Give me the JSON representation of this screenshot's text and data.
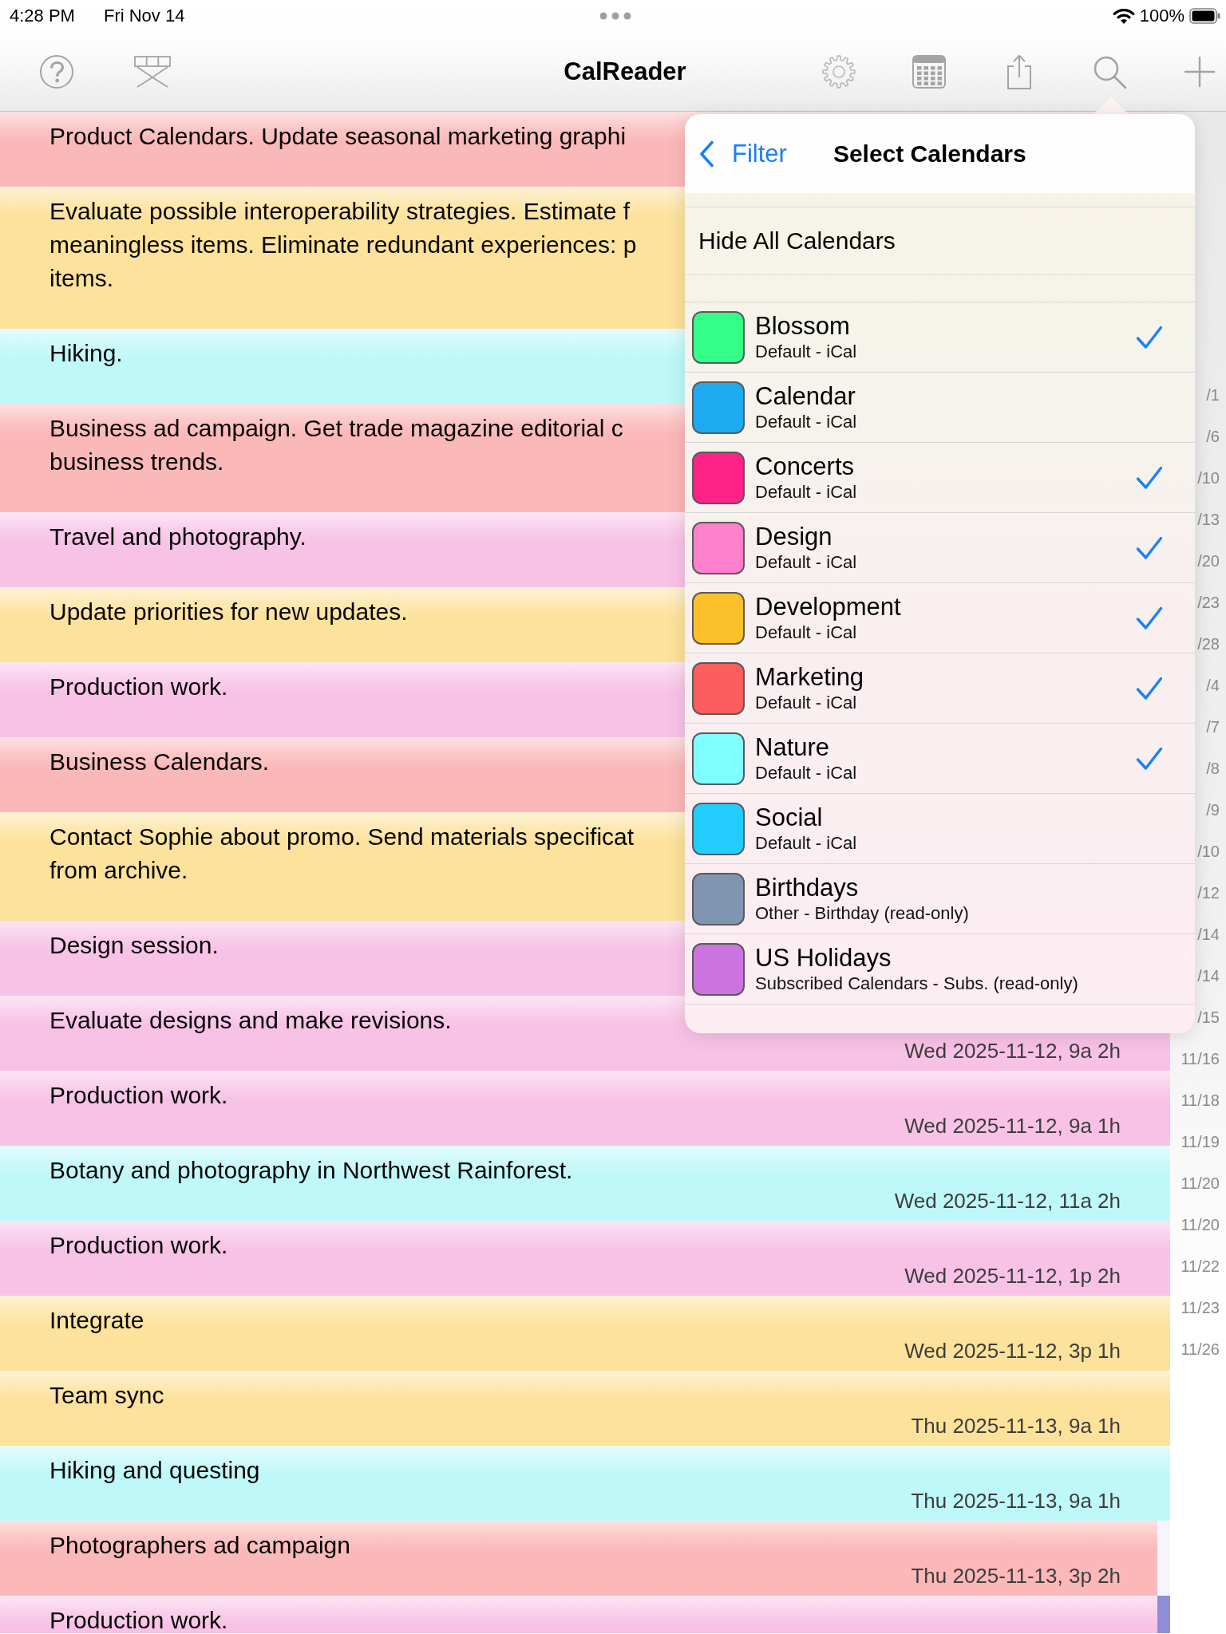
{
  "status_bar": {
    "time": "4:28 PM",
    "date": "Fri Nov 14",
    "battery": "100%"
  },
  "toolbar": {
    "title": "CalReader"
  },
  "events": [
    {
      "lines": [
        "Product Calendars. Update seasonal marketing graphi"
      ],
      "color": "#fbb8b8"
    },
    {
      "lines": [
        "Evaluate possible interoperability strategies. Estimate f",
        "meaningless items. Eliminate redundant experiences: p",
        "items."
      ],
      "color": "#fde29c"
    },
    {
      "lines": [
        "Hiking."
      ],
      "color": "#bff8f8"
    },
    {
      "lines": [
        "Business ad campaign. Get trade magazine editorial c",
        "business trends."
      ],
      "color": "#fbb8b8"
    },
    {
      "lines": [
        "Travel and photography."
      ],
      "color": "#f8c2e6"
    },
    {
      "lines": [
        "Update priorities for new updates."
      ],
      "color": "#fde29c"
    },
    {
      "lines": [
        "Production work."
      ],
      "color": "#f8c2e6"
    },
    {
      "lines": [
        "Business Calendars."
      ],
      "color": "#fbb8b8"
    },
    {
      "lines": [
        "Contact Sophie about promo. Send materials specificat",
        "from archive."
      ],
      "color": "#fde29c"
    },
    {
      "lines": [
        "Design session."
      ],
      "color": "#f8c2e6"
    },
    {
      "lines": [
        "Evaluate designs and make revisions."
      ],
      "date": "Wed 2025-11-12, 9a 2h",
      "color": "#f8c2e6"
    },
    {
      "lines": [
        "Production work."
      ],
      "date": "Wed 2025-11-12, 9a 1h",
      "color": "#f8c2e6"
    },
    {
      "lines": [
        "Botany and photography in Northwest Rainforest."
      ],
      "date": "Wed 2025-11-12, 11a 2h",
      "color": "#bff8f8"
    },
    {
      "lines": [
        "Production work."
      ],
      "date": "Wed 2025-11-12, 1p 2h",
      "color": "#f8c2e6"
    },
    {
      "lines": [
        "Integrate"
      ],
      "date": "Wed 2025-11-12, 3p 1h",
      "color": "#fde29c"
    },
    {
      "lines": [
        "Team sync"
      ],
      "date": "Thu 2025-11-13, 9a 1h",
      "color": "#fde29c"
    },
    {
      "lines": [
        "Hiking and questing"
      ],
      "date": "Thu 2025-11-13, 9a 1h",
      "color": "#bff8f8"
    },
    {
      "lines": [
        "Photographers ad campaign"
      ],
      "date": "Thu 2025-11-13, 3p 2h",
      "color": "#fbb8b8"
    },
    {
      "lines": [
        "Production work."
      ],
      "color": "#f8c2e6"
    }
  ],
  "date_index": [
    "/1",
    "/6",
    "/10",
    "/13",
    "/20",
    "/23",
    "/28",
    "/4",
    "/7",
    "/8",
    "/9",
    "/10",
    "/12",
    "/14",
    "/14",
    "/15",
    "11/16",
    "11/18",
    "11/19",
    "11/20",
    "11/20",
    "11/22",
    "11/23",
    "11/26"
  ],
  "filter_popover": {
    "back_label": "Filter",
    "title": "Select Calendars",
    "hide_all": "Hide All Calendars",
    "calendars": [
      {
        "name": "Blossom",
        "source": "Default - iCal",
        "color": "#33ff88",
        "checked": true
      },
      {
        "name": "Calendar",
        "source": "Default - iCal",
        "color": "#1eaaf1",
        "checked": false
      },
      {
        "name": "Concerts",
        "source": "Default - iCal",
        "color": "#ff2288",
        "checked": true
      },
      {
        "name": "Design",
        "source": "Default - iCal",
        "color": "#ff80cc",
        "checked": true
      },
      {
        "name": "Development",
        "source": "Default - iCal",
        "color": "#fcc02b",
        "checked": true
      },
      {
        "name": "Marketing",
        "source": "Default - iCal",
        "color": "#fc5e5e",
        "checked": true
      },
      {
        "name": "Nature",
        "source": "Default - iCal",
        "color": "#80ffff",
        "checked": true
      },
      {
        "name": "Social",
        "source": "Default - iCal",
        "color": "#22ccff",
        "checked": false
      },
      {
        "name": "Birthdays",
        "source": "Other - Birthday (read-only)",
        "color": "#8095b0",
        "checked": false
      },
      {
        "name": "US Holidays",
        "source": "Subscribed Calendars - Subs. (read-only)",
        "color": "#cc73e1",
        "checked": false
      }
    ]
  }
}
